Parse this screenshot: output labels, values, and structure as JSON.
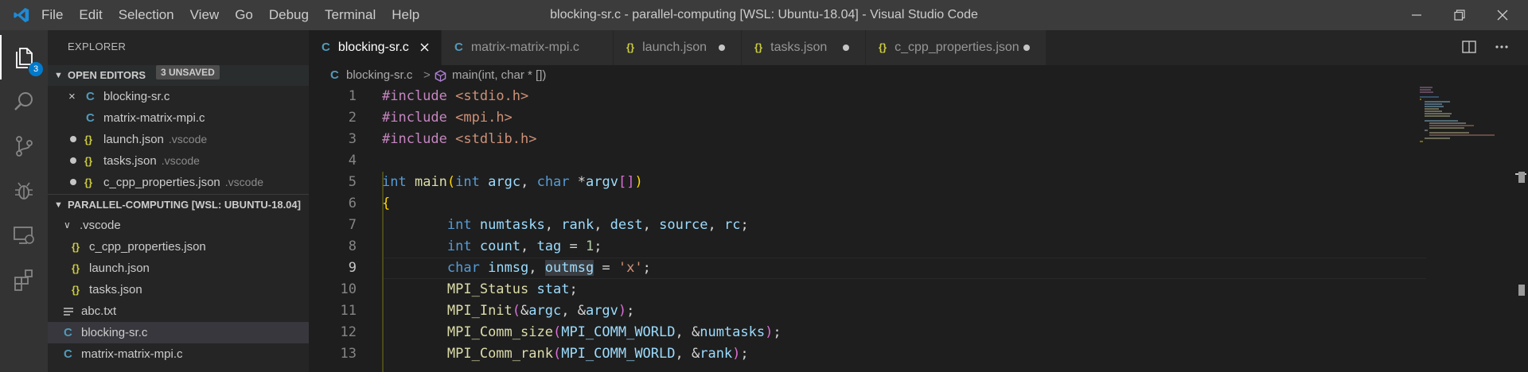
{
  "window": {
    "title": "blocking-sr.c - parallel-computing [WSL: Ubuntu-18.04] - Visual Studio Code"
  },
  "menu": [
    "File",
    "Edit",
    "Selection",
    "View",
    "Go",
    "Debug",
    "Terminal",
    "Help"
  ],
  "activity": {
    "badge": "3"
  },
  "sidebar": {
    "title": "EXPLORER",
    "open_editors": {
      "label": "OPEN EDITORS",
      "unsaved": "3 UNSAVED",
      "items": [
        {
          "name": "blocking-sr.c",
          "icon": "C",
          "marker": "×",
          "hint": ""
        },
        {
          "name": "matrix-matrix-mpi.c",
          "icon": "C",
          "marker": "",
          "hint": ""
        },
        {
          "name": "launch.json",
          "icon": "{}",
          "marker": "dot",
          "hint": ".vscode"
        },
        {
          "name": "tasks.json",
          "icon": "{}",
          "marker": "dot",
          "hint": ".vscode"
        },
        {
          "name": "c_cpp_properties.json",
          "icon": "{}",
          "marker": "dot",
          "hint": ".vscode"
        }
      ]
    },
    "workspace": {
      "label": "PARALLEL-COMPUTING [WSL: UBUNTU-18.04]",
      "items": [
        {
          "name": ".vscode",
          "icon": "folder"
        },
        {
          "name": "c_cpp_properties.json",
          "icon": "{}"
        },
        {
          "name": "launch.json",
          "icon": "{}"
        },
        {
          "name": "tasks.json",
          "icon": "{}"
        },
        {
          "name": "abc.txt",
          "icon": "lines"
        },
        {
          "name": "blocking-sr.c",
          "icon": "C"
        },
        {
          "name": "matrix-matrix-mpi.c",
          "icon": "C"
        }
      ]
    }
  },
  "tabs": [
    {
      "name": "blocking-sr.c",
      "icon": "C",
      "state": "close"
    },
    {
      "name": "matrix-matrix-mpi.c",
      "icon": "C",
      "state": ""
    },
    {
      "name": "launch.json",
      "icon": "{}",
      "state": "dot"
    },
    {
      "name": "tasks.json",
      "icon": "{}",
      "state": "dot"
    },
    {
      "name": "c_cpp_properties.json",
      "icon": "{}",
      "state": "dot"
    }
  ],
  "breadcrumb": {
    "file": "blocking-sr.c",
    "separator": ">",
    "symbol": "main(int, char * [])"
  },
  "editor": {
    "line_numbers": [
      "1",
      "2",
      "3",
      "4",
      "5",
      "6",
      "7",
      "8",
      "9",
      "10",
      "11",
      "12",
      "13"
    ],
    "current_line": 9,
    "colors": {
      "keyword": "#569cd6",
      "preprocessor": "#c586c0",
      "string": "#ce9178",
      "function": "#dcdcaa",
      "variable": "#9cdcfe",
      "number": "#b5cea8"
    },
    "lines": [
      [
        {
          "t": "#include",
          "c": "p"
        },
        {
          "t": " "
        },
        {
          "t": "<stdio.h>",
          "c": "s"
        }
      ],
      [
        {
          "t": "#include",
          "c": "p"
        },
        {
          "t": " "
        },
        {
          "t": "<mpi.h>",
          "c": "s"
        }
      ],
      [
        {
          "t": "#include",
          "c": "p"
        },
        {
          "t": " "
        },
        {
          "t": "<stdlib.h>",
          "c": "s"
        }
      ],
      [],
      [
        {
          "t": "int",
          "c": "k"
        },
        {
          "t": " "
        },
        {
          "t": "main",
          "c": "f"
        },
        {
          "t": "(",
          "c": "b1"
        },
        {
          "t": "int",
          "c": "k"
        },
        {
          "t": " "
        },
        {
          "t": "argc",
          "c": "v"
        },
        {
          "t": ", "
        },
        {
          "t": "char",
          "c": "k"
        },
        {
          "t": " *"
        },
        {
          "t": "argv",
          "c": "v"
        },
        {
          "t": "[]",
          "c": "b2"
        },
        {
          "t": ")",
          "c": "b1"
        }
      ],
      [
        {
          "t": "{",
          "c": "b1"
        }
      ],
      [
        {
          "t": "        "
        },
        {
          "t": "int",
          "c": "k"
        },
        {
          "t": " "
        },
        {
          "t": "numtasks",
          "c": "v"
        },
        {
          "t": ", "
        },
        {
          "t": "rank",
          "c": "v"
        },
        {
          "t": ", "
        },
        {
          "t": "dest",
          "c": "v"
        },
        {
          "t": ", "
        },
        {
          "t": "source",
          "c": "v"
        },
        {
          "t": ", "
        },
        {
          "t": "rc",
          "c": "v"
        },
        {
          "t": ";"
        }
      ],
      [
        {
          "t": "        "
        },
        {
          "t": "int",
          "c": "k"
        },
        {
          "t": " "
        },
        {
          "t": "count",
          "c": "v"
        },
        {
          "t": ", "
        },
        {
          "t": "tag",
          "c": "v"
        },
        {
          "t": " = "
        },
        {
          "t": "1",
          "c": "n"
        },
        {
          "t": ";"
        }
      ],
      [
        {
          "t": "        "
        },
        {
          "t": "char",
          "c": "k"
        },
        {
          "t": " "
        },
        {
          "t": "inmsg",
          "c": "v"
        },
        {
          "t": ", "
        },
        {
          "t": "outmsg",
          "c": "v hl"
        },
        {
          "t": " = "
        },
        {
          "t": "'x'",
          "c": "s"
        },
        {
          "t": ";"
        }
      ],
      [
        {
          "t": "        "
        },
        {
          "t": "MPI_Status",
          "c": "f"
        },
        {
          "t": " "
        },
        {
          "t": "stat",
          "c": "v"
        },
        {
          "t": ";"
        }
      ],
      [
        {
          "t": "        "
        },
        {
          "t": "MPI_Init",
          "c": "f"
        },
        {
          "t": "(",
          "c": "b2"
        },
        {
          "t": "&"
        },
        {
          "t": "argc",
          "c": "v"
        },
        {
          "t": ", &"
        },
        {
          "t": "argv",
          "c": "v"
        },
        {
          "t": ")",
          "c": "b2"
        },
        {
          "t": ";"
        }
      ],
      [
        {
          "t": "        "
        },
        {
          "t": "MPI_Comm_size",
          "c": "f"
        },
        {
          "t": "(",
          "c": "b2"
        },
        {
          "t": "MPI_COMM_WORLD",
          "c": "v"
        },
        {
          "t": ", &"
        },
        {
          "t": "numtasks",
          "c": "v"
        },
        {
          "t": ")",
          "c": "b2"
        },
        {
          "t": ";"
        }
      ],
      [
        {
          "t": "        "
        },
        {
          "t": "MPI_Comm_rank",
          "c": "f"
        },
        {
          "t": "(",
          "c": "b2"
        },
        {
          "t": "MPI_COMM_WORLD",
          "c": "v"
        },
        {
          "t": ", &"
        },
        {
          "t": "rank",
          "c": "v"
        },
        {
          "t": ")",
          "c": "b2"
        },
        {
          "t": ";"
        }
      ]
    ]
  }
}
